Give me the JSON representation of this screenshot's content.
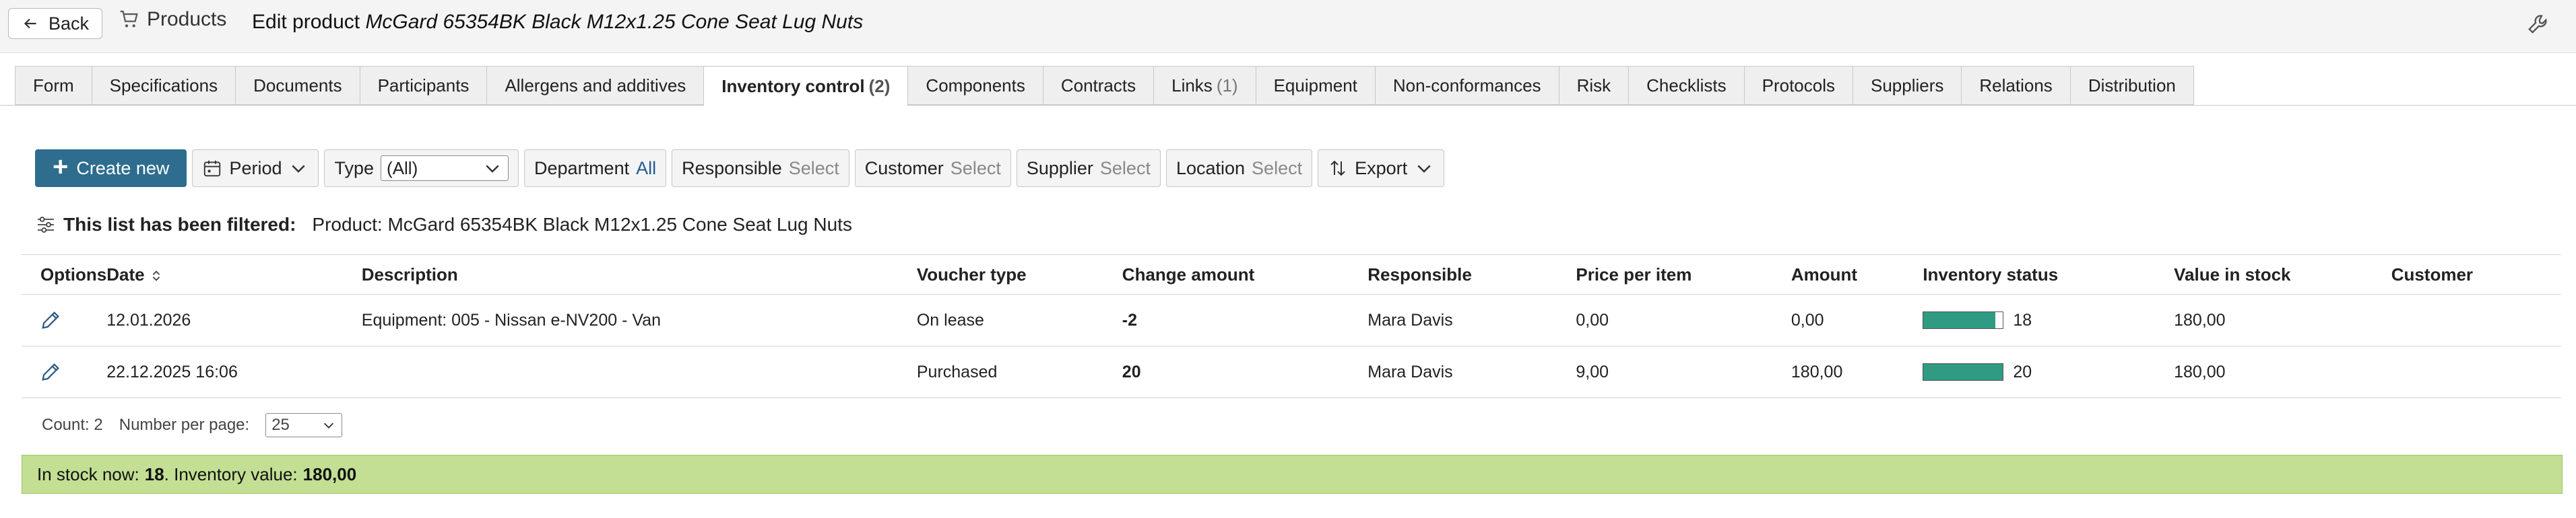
{
  "header": {
    "back_label": "Back",
    "breadcrumb": "Products",
    "title_prefix": "Edit product",
    "title_product": "McGard 65354BK Black M12x1.25 Cone Seat Lug Nuts"
  },
  "tabs": [
    {
      "label": "Form",
      "count": ""
    },
    {
      "label": "Specifications",
      "count": ""
    },
    {
      "label": "Documents",
      "count": ""
    },
    {
      "label": "Participants",
      "count": ""
    },
    {
      "label": "Allergens and additives",
      "count": ""
    },
    {
      "label": "Inventory control",
      "count": "(2)",
      "active": true
    },
    {
      "label": "Components",
      "count": ""
    },
    {
      "label": "Contracts",
      "count": ""
    },
    {
      "label": "Links",
      "count": "(1)"
    },
    {
      "label": "Equipment",
      "count": ""
    },
    {
      "label": "Non-conformances",
      "count": ""
    },
    {
      "label": "Risk",
      "count": ""
    },
    {
      "label": "Checklists",
      "count": ""
    },
    {
      "label": "Protocols",
      "count": ""
    },
    {
      "label": "Suppliers",
      "count": ""
    },
    {
      "label": "Relations",
      "count": ""
    },
    {
      "label": "Distribution",
      "count": ""
    }
  ],
  "toolbar": {
    "create_label": "Create new",
    "period_label": "Period",
    "type_label": "Type",
    "type_value": "(All)",
    "department_label": "Department",
    "department_value": "All",
    "responsible_label": "Responsible",
    "responsible_value": "Select",
    "customer_label": "Customer",
    "customer_value": "Select",
    "supplier_label": "Supplier",
    "supplier_value": "Select",
    "location_label": "Location",
    "location_value": "Select",
    "export_label": "Export"
  },
  "filter": {
    "label": "This list has been filtered:",
    "text": "Product: McGard 65354BK Black M12x1.25 Cone Seat Lug Nuts"
  },
  "table": {
    "columns": {
      "options": "Options",
      "date": "Date",
      "description": "Description",
      "voucher_type": "Voucher type",
      "change_amount": "Change amount",
      "responsible": "Responsible",
      "price_per_item": "Price per item",
      "amount": "Amount",
      "inventory_status": "Inventory status",
      "value_in_stock": "Value in stock",
      "customer": "Customer"
    },
    "rows": [
      {
        "date": "12.01.2026",
        "description": "Equipment: 005 - Nissan e-NV200 - Van",
        "voucher_type": "On lease",
        "change_amount": "-2",
        "responsible": "Mara Davis",
        "price_per_item": "0,00",
        "amount": "0,00",
        "inventory_status": "18",
        "inventory_fill": 0.9,
        "value_in_stock": "180,00",
        "customer": ""
      },
      {
        "date": "22.12.2025 16:06",
        "description": "",
        "voucher_type": "Purchased",
        "change_amount": "20",
        "responsible": "Mara Davis",
        "price_per_item": "9,00",
        "amount": "180,00",
        "inventory_status": "20",
        "inventory_fill": 1.0,
        "value_in_stock": "180,00",
        "customer": ""
      }
    ]
  },
  "pager": {
    "count_label": "Count: 2",
    "per_page_label": "Number per page:",
    "per_page_value": "25"
  },
  "summary": {
    "prefix": "In stock now:",
    "stock": "18",
    "mid": ". Inventory value:",
    "value": "180,00"
  },
  "colors": {
    "primary": "#2e6d8e",
    "link": "#1f5d94",
    "negative": "#d81a1a",
    "positive": "#1e8a1e",
    "bar_fill": "#2e9b82",
    "summary_bg": "#c2df93"
  }
}
